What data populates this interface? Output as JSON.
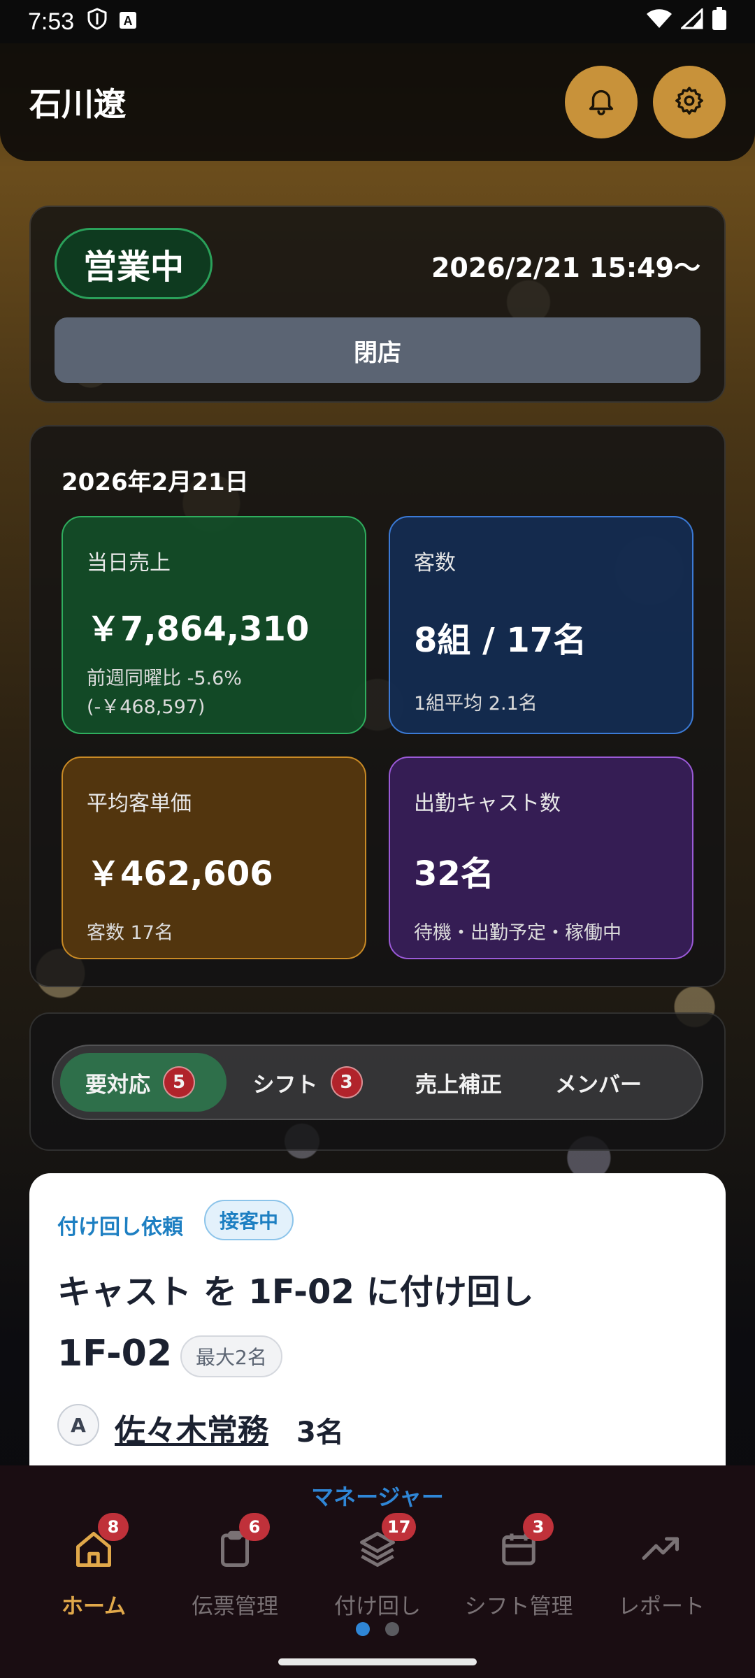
{
  "status_bar": {
    "time": "7:53",
    "a_badge": "A"
  },
  "header": {
    "user_name": "石川遼"
  },
  "store": {
    "status": "営業中",
    "open_since": "2026/2/21 15:49〜",
    "close_label": "閉店"
  },
  "stats": {
    "date": "2026年2月21日",
    "sales": {
      "label": "当日売上",
      "value": "￥7,864,310",
      "sub1": "前週同曜比 -5.6%",
      "sub2": "(-￥468,597)"
    },
    "guests": {
      "label": "客数",
      "value": "8組 / 17名",
      "sub": "1組平均 2.1名"
    },
    "avg_price": {
      "label": "平均客単価",
      "value": "￥462,606",
      "sub": "客数 17名"
    },
    "cast": {
      "label": "出勤キャスト数",
      "value": "32名",
      "sub": "待機・出勤予定・稼働中"
    }
  },
  "tabs": [
    {
      "label": "要対応",
      "badge": "5"
    },
    {
      "label": "シフト",
      "badge": "3"
    },
    {
      "label": "売上補正"
    },
    {
      "label": "メンバー"
    }
  ],
  "request": {
    "type": "付け回し依頼",
    "status": "接客中",
    "title": "キャスト を 1F-02 に付け回し",
    "table": "1F-02",
    "capacity": "最大2名",
    "avatar_letter": "A",
    "person": "佐々木常務",
    "count": "3名"
  },
  "bottom_nav": {
    "role": "マネージャー",
    "items": [
      {
        "label": "ホーム",
        "badge": "8",
        "icon": "home-icon"
      },
      {
        "label": "伝票管理",
        "badge": "6",
        "icon": "clipboard-icon"
      },
      {
        "label": "付け回し",
        "badge": "17",
        "icon": "layers-icon"
      },
      {
        "label": "シフト管理",
        "badge": "3",
        "icon": "calendar-icon"
      },
      {
        "label": "レポート",
        "icon": "trending-up-icon"
      }
    ]
  },
  "colors": {
    "accent": "#c8923a",
    "active_nav": "#e1a84a",
    "role_blue": "#2f86d6",
    "badge_red": "#c0313a"
  }
}
